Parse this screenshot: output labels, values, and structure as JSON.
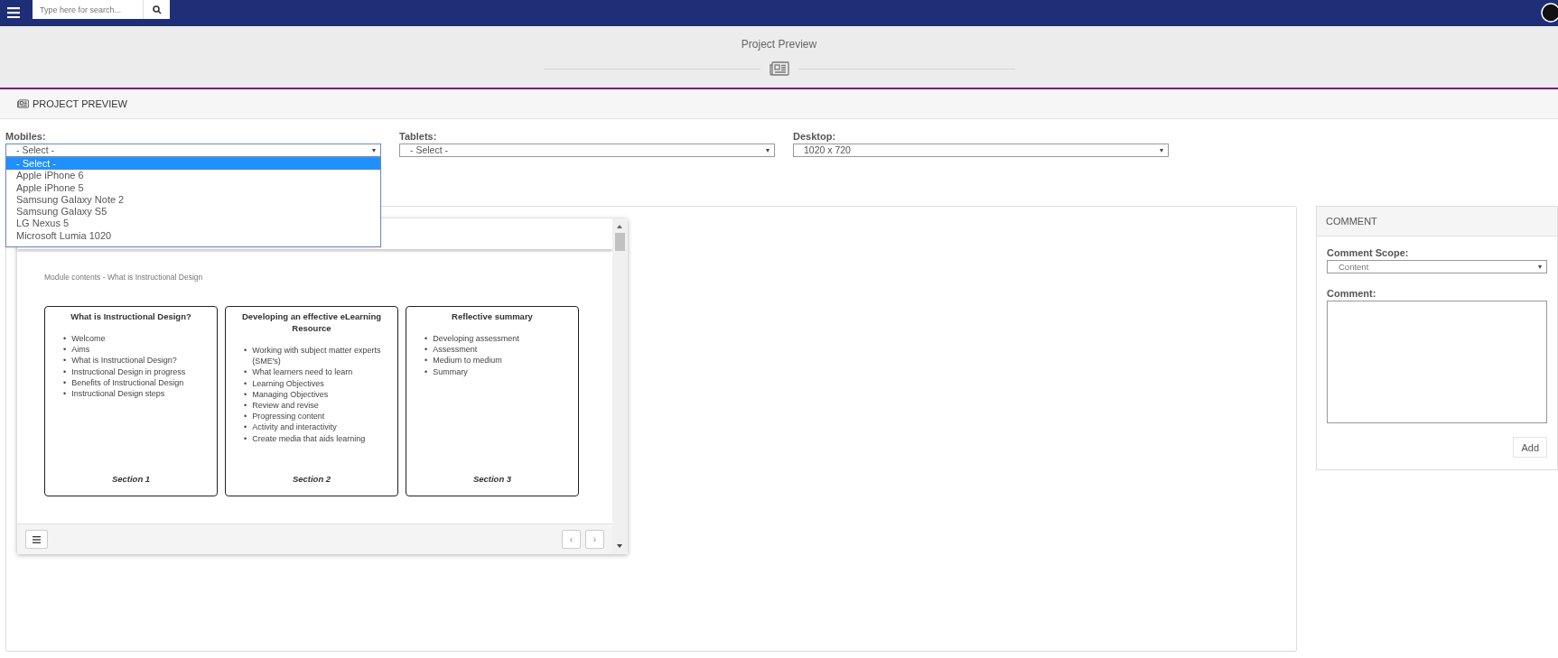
{
  "top_bar": {
    "search": {
      "placeholder": "Type here for search..."
    }
  },
  "header": {
    "title": "Project Preview"
  },
  "section": {
    "title": "PROJECT PREVIEW"
  },
  "device_selects": [
    {
      "label": "Mobiles:",
      "value": "- Select -",
      "open": true,
      "options": [
        {
          "label": "- Select -",
          "selected": true
        },
        {
          "label": "Apple iPhone 6",
          "selected": false
        },
        {
          "label": "Apple iPhone 5",
          "selected": false
        },
        {
          "label": "Samsung Galaxy Note 2",
          "selected": false
        },
        {
          "label": "Samsung Galaxy S5",
          "selected": false
        },
        {
          "label": "LG Nexus 5",
          "selected": false
        },
        {
          "label": "Microsoft Lumia 1020",
          "selected": false
        }
      ]
    },
    {
      "label": "Tablets:",
      "value": "- Select -",
      "open": false
    },
    {
      "label": "Desktop:",
      "value": "1020 x 720",
      "open": false
    }
  ],
  "preview": {
    "module_title": "Module contents - What is Instructional Design",
    "sections": [
      {
        "title": "What is Instructional Design?",
        "items": [
          "Welcome",
          "Aims",
          "What is Instructional Design?",
          "Instructional Design in progress",
          "Benefits of Instructional Design",
          "Instructional Design steps"
        ],
        "footer": "Section 1"
      },
      {
        "title": "Developing an effective eLearning Resource",
        "items": [
          "Working with subject matter experts (SME's)",
          "What learners need to learn",
          "Learning Objectives",
          "Managing Objectives",
          "Review and revise",
          "Progressing content",
          "Activity and interactivity",
          "Create media that aids learning"
        ],
        "footer": "Section 2"
      },
      {
        "title": "Reflective summary",
        "items": [
          "Developing assessment",
          "Assessment",
          "Medium to medium",
          "Summary"
        ],
        "footer": "Section 3"
      }
    ],
    "bullet": "•",
    "nav_prev": "‹",
    "nav_next": "›"
  },
  "comment": {
    "title": "COMMENT",
    "scope_label": "Comment Scope:",
    "scope_value": "Content",
    "comment_label": "Comment:",
    "add_button": "Add"
  }
}
